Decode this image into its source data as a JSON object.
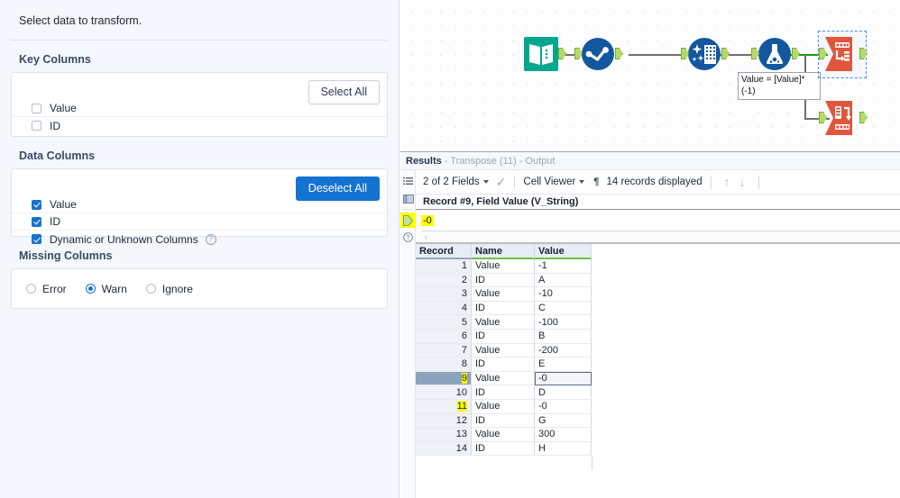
{
  "config_panel": {
    "intro": "Select data to transform.",
    "key_columns": {
      "label": "Key Columns",
      "button": "Select All",
      "button_name": "select-all-button",
      "items": [
        {
          "label": "Value",
          "checked": false
        },
        {
          "label": "ID",
          "checked": false
        }
      ]
    },
    "data_columns": {
      "label": "Data Columns",
      "button": "Deselect All",
      "button_name": "deselect-all-button",
      "items": [
        {
          "label": "Value",
          "checked": true,
          "help": false
        },
        {
          "label": "ID",
          "checked": true,
          "help": false
        },
        {
          "label": "Dynamic or Unknown Columns",
          "checked": true,
          "help": true
        }
      ],
      "help_glyph": "?"
    },
    "missing_columns": {
      "label": "Missing Columns",
      "options": [
        {
          "label": "Error",
          "selected": false
        },
        {
          "label": "Warn",
          "selected": true
        },
        {
          "label": "Ignore",
          "selected": false
        }
      ]
    }
  },
  "canvas": {
    "annotation": "Value = [Value]*(-1)",
    "nodes": [
      {
        "name": "text-input-tool",
        "icon": "book-icon",
        "color": "#00a78e"
      },
      {
        "name": "select-tool",
        "icon": "select-circle-icon",
        "color": "#1257a0"
      },
      {
        "name": "data-cleansing-tool",
        "icon": "cleanse-building-icon",
        "color": "#1257a0"
      },
      {
        "name": "formula-tool",
        "icon": "flask-icon",
        "color": "#1257a0"
      },
      {
        "name": "transpose-tool",
        "icon": "transpose-icon",
        "color": "#e0553c",
        "selected": true
      },
      {
        "name": "crosstab-tool",
        "icon": "crosstab-icon",
        "color": "#e0553c",
        "selected": false
      }
    ]
  },
  "results": {
    "title_prefix": "Results",
    "title_suffix": "- Transpose (11) - Output",
    "toolbar": {
      "fields": "2 of 2 Fields",
      "check_glyph": "✓",
      "view_mode": "Cell Viewer",
      "pilcrow_glyph": "¶",
      "records": "14 records displayed",
      "up_glyph": "↑",
      "down_glyph": "↓"
    },
    "cell_viewer": {
      "header": "Record #9, Field Value (V_String)",
      "value": "-0",
      "scroll_glyph": "‹"
    },
    "grid": {
      "columns": [
        "Record",
        "Name",
        "Value"
      ],
      "rows": [
        {
          "record": "1",
          "name": "Value",
          "value": "-1",
          "selected": false,
          "highlight": false
        },
        {
          "record": "2",
          "name": "ID",
          "value": "A",
          "selected": false,
          "highlight": false
        },
        {
          "record": "3",
          "name": "Value",
          "value": "-10",
          "selected": false,
          "highlight": false
        },
        {
          "record": "4",
          "name": "ID",
          "value": "C",
          "selected": false,
          "highlight": false
        },
        {
          "record": "5",
          "name": "Value",
          "value": "-100",
          "selected": false,
          "highlight": false
        },
        {
          "record": "6",
          "name": "ID",
          "value": "B",
          "selected": false,
          "highlight": false
        },
        {
          "record": "7",
          "name": "Value",
          "value": "-200",
          "selected": false,
          "highlight": false
        },
        {
          "record": "8",
          "name": "ID",
          "value": "E",
          "selected": false,
          "highlight": false
        },
        {
          "record": "9",
          "name": "Value",
          "value": "-0",
          "selected": true,
          "highlight": true
        },
        {
          "record": "10",
          "name": "ID",
          "value": "D",
          "selected": false,
          "highlight": false
        },
        {
          "record": "11",
          "name": "Value",
          "value": "-0",
          "selected": false,
          "highlight": true
        },
        {
          "record": "12",
          "name": "ID",
          "value": "G",
          "selected": false,
          "highlight": false
        },
        {
          "record": "13",
          "name": "Value",
          "value": "300",
          "selected": false,
          "highlight": false
        },
        {
          "record": "14",
          "name": "ID",
          "value": "H",
          "selected": false,
          "highlight": false
        }
      ]
    }
  },
  "colors": {
    "accent": "#1472d1",
    "alteryx_green": "#00a78e",
    "alteryx_blue": "#1257a0",
    "alteryx_orange": "#e0553c",
    "highlight": "#ffff00",
    "anchor_green": "#b5d96a"
  }
}
